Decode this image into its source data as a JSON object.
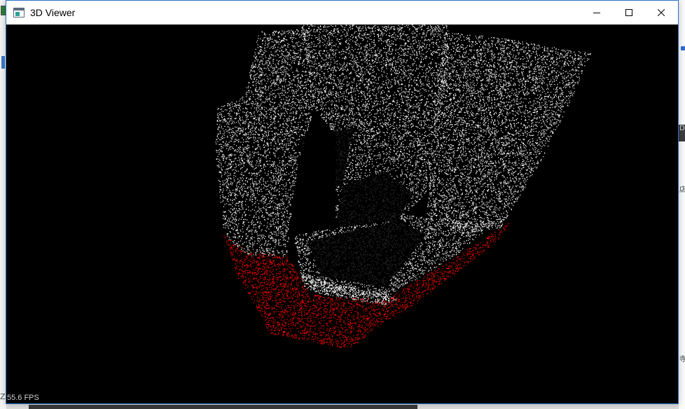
{
  "window": {
    "title": "3D Viewer"
  },
  "icons": {
    "app": "app-window-icon",
    "minimize": "minimize-icon",
    "maximize": "maximize-icon",
    "close": "close-icon"
  },
  "viewport": {
    "fps_text": "55.6 FPS",
    "background_color": "#000000",
    "point_color_primary": "#ffffff",
    "point_color_highlight": "#ff0000"
  },
  "background": {
    "right_glyphs": [
      "D",
      "店",
      "寺"
    ],
    "left_glyph": "Z"
  },
  "colors": {
    "window_border": "#2b72c8",
    "titlebar_bg": "#ffffff",
    "title_text": "#000000"
  }
}
